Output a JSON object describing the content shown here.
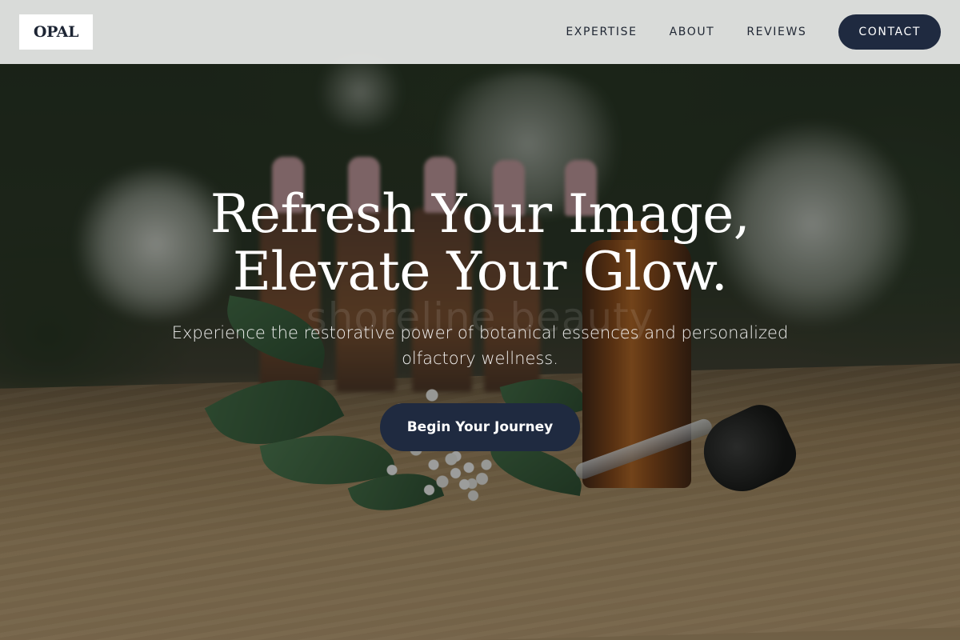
{
  "brand": {
    "logo_text": "OPAL"
  },
  "nav": {
    "links": [
      {
        "label": "EXPERTISE"
      },
      {
        "label": "ABOUT"
      },
      {
        "label": "REVIEWS"
      }
    ],
    "contact_label": "CONTACT"
  },
  "hero": {
    "headline_line1": "Refresh Your Image,",
    "headline_line2": "Elevate Your Glow.",
    "subtext": "Experience the restorative power of botanical essences and personalized olfactory wellness.",
    "cta_label": "Begin Your Journey",
    "watermark": "shoreline beauty"
  },
  "colors": {
    "primary_dark": "#1f2a40",
    "nav_bg": "#eef0ee",
    "text_light": "#ffffff"
  }
}
